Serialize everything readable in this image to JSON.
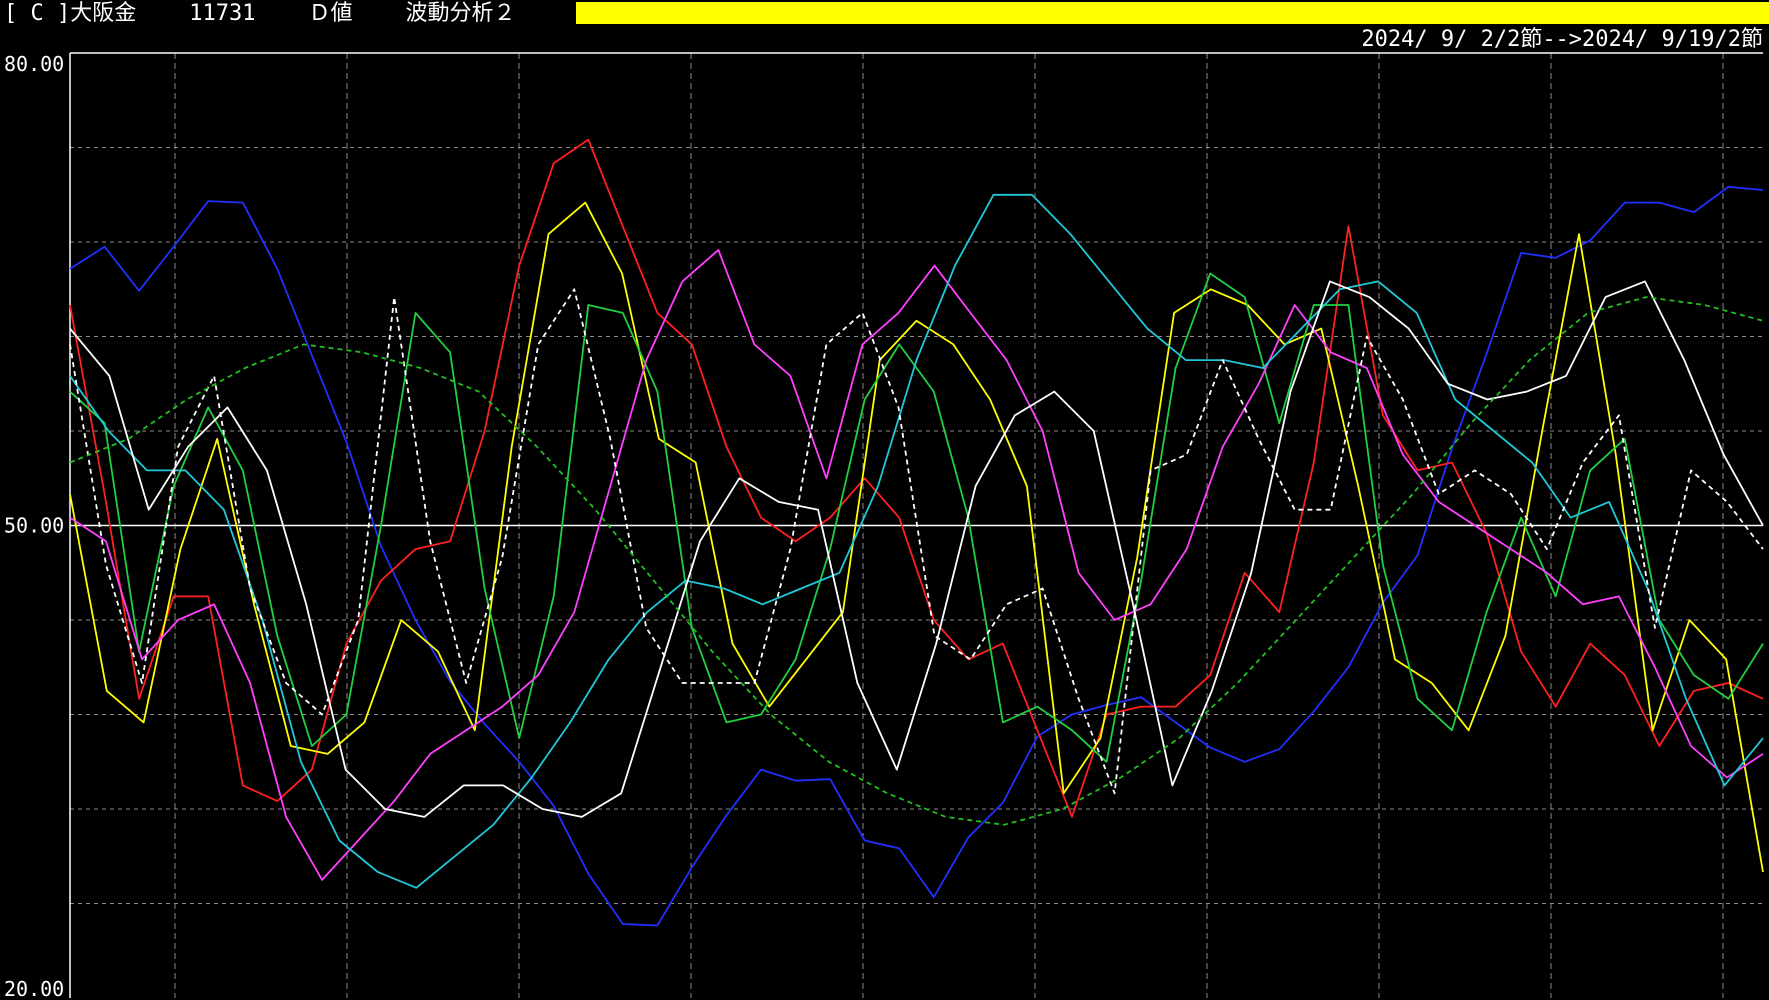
{
  "header": {
    "symbol": "[ C ]大阪金",
    "code": "11731",
    "value_type": "Ｄ値",
    "analysis": "波動分析２",
    "bar_color": "#ffff00"
  },
  "date_range": "2024/ 9/ 2/2節-->2024/ 9/19/2節",
  "chart_data": {
    "type": "line",
    "ylim": [
      20,
      80
    ],
    "y_tick_labels": [
      "80.00",
      "50.00",
      "20.00"
    ],
    "grid": true,
    "reference_line": 50,
    "n_points": 50,
    "series": [
      {
        "color": "#2030ff",
        "dashed": false,
        "values": [
          66.3,
          67.7,
          64.9,
          67.7,
          70.6,
          70.5,
          66.3,
          60.8,
          55.3,
          48.7,
          44.0,
          40.1,
          37.4,
          35.0,
          32.2,
          27.9,
          24.7,
          24.6,
          28.3,
          31.6,
          34.5,
          33.8,
          33.9,
          30.0,
          29.5,
          26.4,
          30.2,
          32.4,
          36.6,
          38.0,
          38.6,
          39.1,
          37.5,
          35.9,
          35.0,
          35.8,
          38.2,
          41.0,
          45.1,
          48.1,
          54.9,
          60.9,
          67.3,
          67.0,
          68.1,
          70.5,
          70.5,
          69.9,
          71.5,
          71.3
        ]
      },
      {
        "color": "#ff2020",
        "dashed": false,
        "values": [
          64.0,
          52.0,
          39.0,
          45.5,
          45.5,
          33.5,
          32.5,
          34.5,
          42.5,
          46.5,
          48.5,
          49.0,
          56.0,
          66.5,
          73.0,
          74.5,
          69.0,
          63.5,
          61.5,
          55.0,
          50.5,
          49.0,
          50.5,
          53.0,
          50.5,
          44.0,
          41.5,
          42.5,
          37.0,
          31.5,
          38.0,
          38.5,
          38.5,
          40.5,
          47.0,
          44.5,
          54.0,
          69.0,
          57.0,
          53.5,
          54.0,
          49.5,
          42.0,
          38.5,
          42.5,
          40.5,
          36.0,
          39.5,
          40.0,
          39.0
        ]
      },
      {
        "color": "#ffff00",
        "dashed": false,
        "values": [
          52.0,
          39.5,
          37.5,
          48.5,
          55.5,
          45.0,
          36.0,
          35.5,
          37.5,
          44.0,
          42.0,
          37.0,
          55.0,
          68.5,
          70.5,
          66.0,
          55.5,
          54.0,
          42.5,
          38.5,
          41.5,
          44.5,
          60.5,
          63.0,
          61.5,
          58.0,
          52.5,
          33.0,
          36.5,
          48.0,
          63.5,
          65.0,
          64.0,
          61.5,
          62.5,
          52.5,
          41.5,
          40.0,
          37.0,
          43.0,
          56.0,
          68.5,
          54.5,
          37.0,
          44.0,
          41.5,
          28.0
        ]
      },
      {
        "color": "#20d040",
        "dashed": false,
        "values": [
          58.5,
          56.5,
          42.0,
          52.5,
          57.5,
          53.5,
          43.0,
          36.0,
          38.0,
          50.0,
          63.5,
          61.0,
          46.0,
          36.5,
          45.5,
          64.0,
          63.5,
          58.5,
          43.5,
          37.5,
          38.0,
          41.5,
          48.5,
          58.0,
          61.5,
          58.5,
          50.5,
          37.5,
          38.5,
          37.0,
          35.0,
          46.5,
          60.0,
          66.0,
          64.5,
          56.5,
          64.0,
          64.0,
          47.5,
          39.0,
          37.0,
          44.5,
          50.5,
          45.5,
          53.5,
          55.5,
          44.0,
          40.5,
          39.0,
          42.5
        ]
      },
      {
        "color": "#ff40ff",
        "dashed": false,
        "values": [
          50.5,
          49.0,
          41.5,
          44.0,
          45.0,
          40.0,
          31.5,
          27.5,
          30.0,
          32.5,
          35.5,
          37.0,
          38.5,
          40.5,
          44.5,
          52.5,
          60.5,
          65.5,
          67.5,
          61.5,
          59.5,
          53.0,
          61.5,
          63.5,
          66.5,
          63.5,
          60.5,
          56.0,
          47.0,
          44.0,
          45.0,
          48.5,
          55.0,
          59.0,
          64.0,
          61.0,
          60.0,
          54.5,
          51.5,
          50.0,
          48.5,
          47.0,
          45.0,
          45.5,
          41.0,
          36.0,
          34.0,
          35.5
        ]
      },
      {
        "color": "#20c8d8",
        "dashed": false,
        "values": [
          59.5,
          56.0,
          53.5,
          53.5,
          51.0,
          44.0,
          35.0,
          30.0,
          28.0,
          27.0,
          29.0,
          31.0,
          34.0,
          37.5,
          41.5,
          44.5,
          46.5,
          46.0,
          45.0,
          46.0,
          47.0,
          52.5,
          60.5,
          66.5,
          71.0,
          71.0,
          68.5,
          65.5,
          62.5,
          60.5,
          60.5,
          60.0,
          62.5,
          65.0,
          65.5,
          63.5,
          58.0,
          56.0,
          54.0,
          50.5,
          51.5,
          46.0,
          39.0,
          33.5,
          36.5
        ]
      },
      {
        "color": "#ffffff",
        "dashed": false,
        "values": [
          62.5,
          59.5,
          51.0,
          55.0,
          57.5,
          53.5,
          45.0,
          34.5,
          32.0,
          31.5,
          33.5,
          33.5,
          32.0,
          31.5,
          33.0,
          41.0,
          49.0,
          53.0,
          51.5,
          51.0,
          40.0,
          34.5,
          42.5,
          52.5,
          57.0,
          58.5,
          56.0,
          45.0,
          33.5,
          39.5,
          47.0,
          58.5,
          65.5,
          64.5,
          62.5,
          59.0,
          58.0,
          58.5,
          59.5,
          64.5,
          65.5,
          60.5,
          54.5,
          50.0
        ]
      },
      {
        "color": "#ffffff",
        "dashed": true,
        "values": [
          61.5,
          47.5,
          40.0,
          55.0,
          59.5,
          46.0,
          40.0,
          38.0,
          44.0,
          64.5,
          49.0,
          40.0,
          48.0,
          61.5,
          65.0,
          55.5,
          43.5,
          40.0,
          40.0,
          40.0,
          48.5,
          61.5,
          63.5,
          57.5,
          43.0,
          41.5,
          45.0,
          46.0,
          39.0,
          33.0,
          53.5,
          54.5,
          60.5,
          55.5,
          51.0,
          51.0,
          62.0,
          58.0,
          52.0,
          53.5,
          52.0,
          48.5,
          54.0,
          57.0,
          43.5,
          53.5,
          51.5,
          48.5
        ]
      },
      {
        "color": "#20c020",
        "dashed": true,
        "curve": true,
        "values": [
          54.0,
          55.5,
          58.0,
          60.0,
          61.5,
          61.0,
          60.0,
          58.5,
          55.0,
          51.0,
          46.5,
          42.0,
          38.0,
          35.0,
          33.0,
          31.5,
          31.0,
          32.0,
          34.0,
          36.5,
          40.0,
          44.0,
          48.0,
          52.0,
          56.5,
          60.5,
          63.5,
          64.5,
          64.0,
          63.0
        ]
      }
    ]
  }
}
